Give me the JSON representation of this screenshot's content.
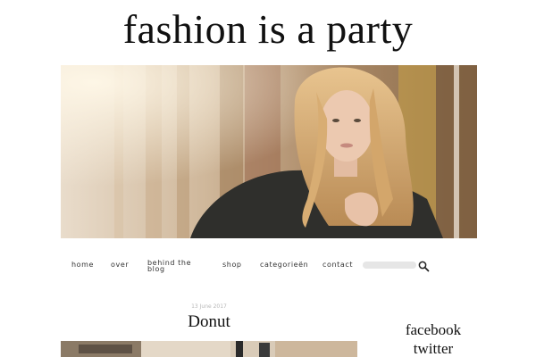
{
  "blog": {
    "title": "fashion is a party"
  },
  "nav": {
    "items": [
      {
        "label": "home"
      },
      {
        "label": "over"
      },
      {
        "label": "behind the blog"
      },
      {
        "label": "shop"
      },
      {
        "label": "categorieën"
      },
      {
        "label": "contact"
      }
    ],
    "search_placeholder": ""
  },
  "post": {
    "date": "13 June 2017",
    "title": "Donut"
  },
  "sidebar": {
    "links": [
      {
        "label": "facebook"
      },
      {
        "label": "twitter"
      }
    ]
  }
}
